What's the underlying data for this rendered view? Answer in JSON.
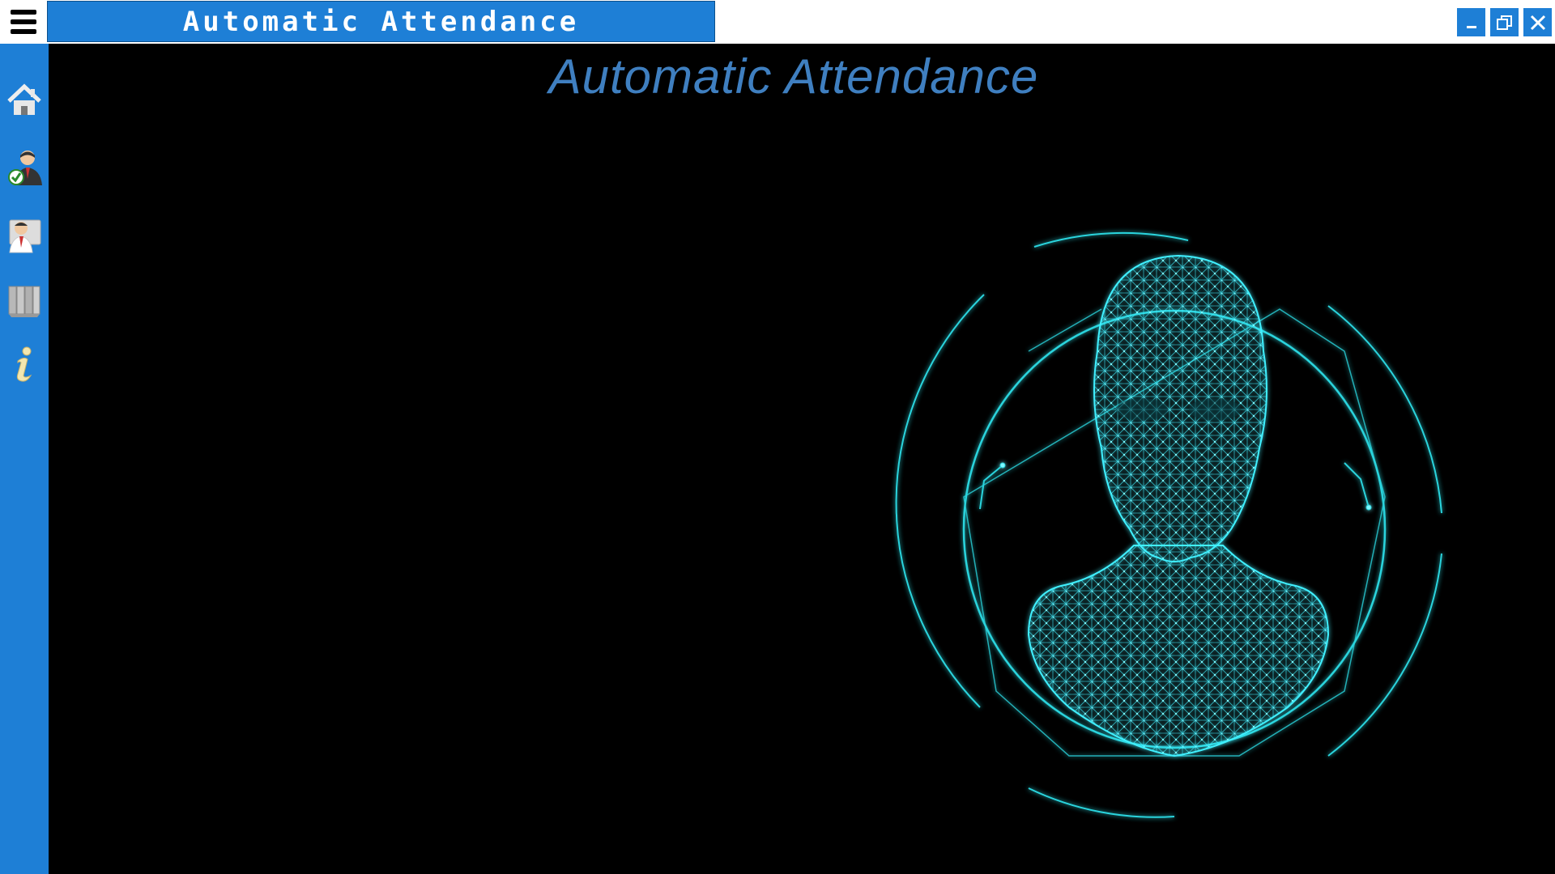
{
  "window": {
    "title": "Automatic Attendance",
    "controls": [
      "minimize-icon",
      "restore-icon",
      "close-icon"
    ]
  },
  "sidebar": {
    "items": [
      {
        "icon": "home-icon"
      },
      {
        "icon": "attendance-user-check-icon"
      },
      {
        "icon": "employee-register-icon"
      },
      {
        "icon": "records-binders-icon"
      },
      {
        "icon": "info-icon"
      }
    ]
  },
  "main": {
    "heading": "Automatic Attendance",
    "illustration": "face-mesh-scan-icon"
  },
  "colors": {
    "accent": "#1e7fd6",
    "heading": "#3f7fc0",
    "mesh": "#3ff0ff",
    "background": "#000000"
  }
}
